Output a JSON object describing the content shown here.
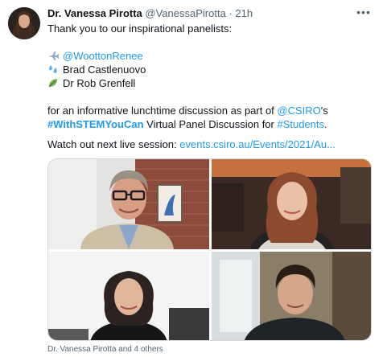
{
  "author": {
    "name": "Dr. Vanessa Pirotta",
    "handle": "@VanessaPirotta",
    "separator": "·",
    "time": "21h"
  },
  "more_icon": "more-dots-icon",
  "tweet": {
    "line1": "Thank you to our inspirational panelists:",
    "panelists": [
      {
        "emoji": "airplane",
        "text": "@WoottonRenee",
        "is_link": true
      },
      {
        "emoji": "droplets",
        "text": "Brad Castlenuovo",
        "is_link": false
      },
      {
        "emoji": "leaf",
        "text": "Dr Rob Grenfell",
        "is_link": false
      }
    ],
    "para_a": "for an informative lunchtime discussion as part of ",
    "mention_csiro": "@CSIRO",
    "para_a_end": "'s",
    "hashtag1": "#WithSTEMYouCan",
    "para_b": " Virtual Panel Discussion for ",
    "hashtag2": "#Students",
    "para_b_end": ".",
    "watch_prefix": "Watch out next live session: ",
    "watch_link": "events.csiro.au/Events/2021/Au..."
  },
  "media": {
    "tiles": [
      "panelist-man-glasses",
      "panelist-woman-red-hair",
      "panelist-woman-dark-hair",
      "panelist-young-man"
    ]
  },
  "caption": "Dr. Vanessa Pirotta and 4 others",
  "colors": {
    "link": "#1d9bf0",
    "muted": "#536471",
    "text": "#0f1419"
  }
}
